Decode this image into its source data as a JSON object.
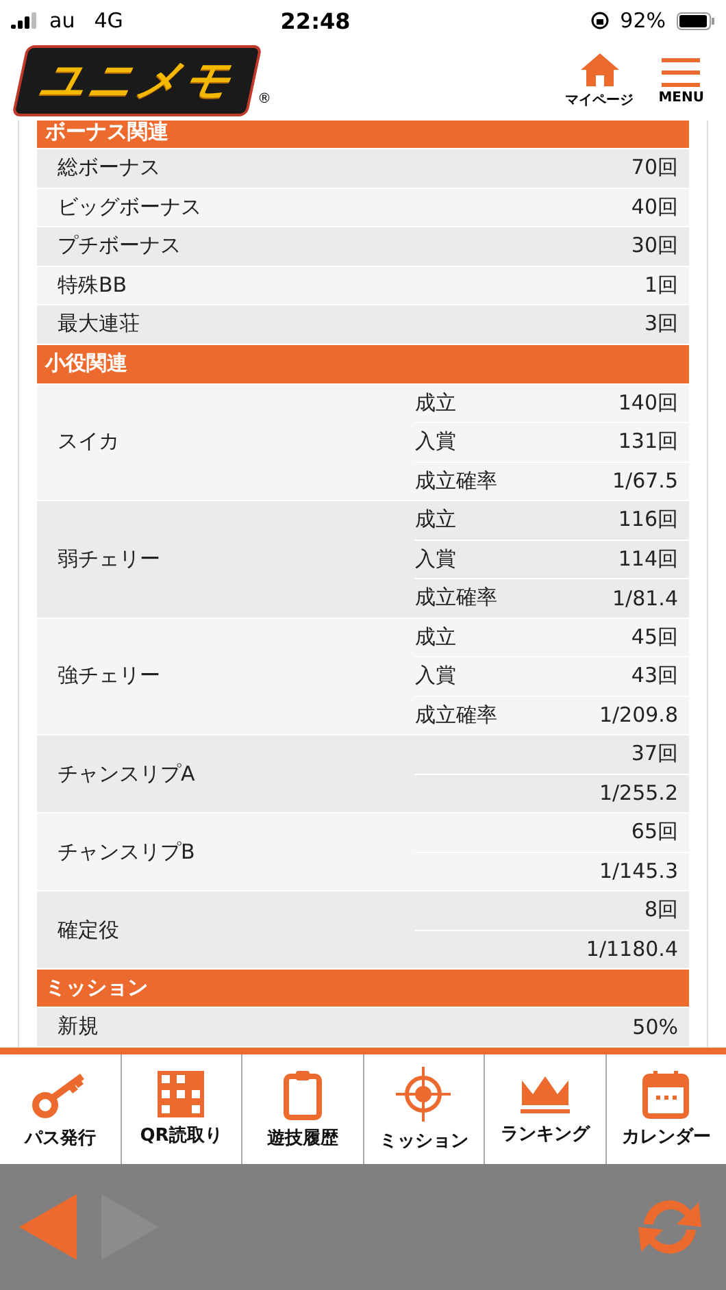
{
  "status_bar": {
    "carrier": "au",
    "network": "4G",
    "time": "22:48",
    "battery": "92%"
  },
  "header": {
    "logo": "ユニメモ",
    "logo_mark": "®",
    "buttons": [
      {
        "kind": "home",
        "label": "マイページ"
      },
      {
        "kind": "menu",
        "label": "MENU"
      }
    ]
  },
  "bonus": {
    "title": "ボーナス関連",
    "rows": [
      {
        "label": "総ボーナス",
        "value": "70回"
      },
      {
        "label": "ビッグボーナス",
        "value": "40回"
      },
      {
        "label": "プチボーナス",
        "value": "30回"
      },
      {
        "label": "特殊BB",
        "value": "1回"
      },
      {
        "label": "最大連荘",
        "value": "3回"
      }
    ]
  },
  "small_roles": {
    "title": "小役関連",
    "groups": [
      {
        "label": "スイカ",
        "rows": [
          {
            "label": "成立",
            "value": "140回"
          },
          {
            "label": "入賞",
            "value": "131回"
          },
          {
            "label": "成立確率",
            "value": "1/67.5"
          }
        ]
      },
      {
        "label": "弱チェリー",
        "rows": [
          {
            "label": "成立",
            "value": "116回"
          },
          {
            "label": "入賞",
            "value": "114回"
          },
          {
            "label": "成立確率",
            "value": "1/81.4"
          }
        ]
      },
      {
        "label": "強チェリー",
        "rows": [
          {
            "label": "成立",
            "value": "45回"
          },
          {
            "label": "入賞",
            "value": "43回"
          },
          {
            "label": "成立確率",
            "value": "1/209.8"
          }
        ]
      },
      {
        "label": "チャンスリプA",
        "rows": [
          {
            "value": "37回"
          },
          {
            "value": "1/255.2"
          }
        ]
      },
      {
        "label": "チャンスリプB",
        "rows": [
          {
            "value": "65回"
          },
          {
            "value": "1/145.3"
          }
        ]
      },
      {
        "label": "確定役",
        "rows": [
          {
            "value": "8回"
          },
          {
            "value": "1/1180.4"
          }
        ]
      }
    ]
  },
  "mission": {
    "title": "ミッション",
    "rows": [
      {
        "label": "新規",
        "value": "50%"
      }
    ]
  },
  "bottom_nav": [
    {
      "kind": "key",
      "label": "パス発行"
    },
    {
      "kind": "qr",
      "label": "QR読取り"
    },
    {
      "kind": "clipboard",
      "label": "遊技履歴"
    },
    {
      "kind": "target",
      "label": "ミッション"
    },
    {
      "kind": "crown",
      "label": "ランキング"
    },
    {
      "kind": "calendar",
      "label": "カレンダー"
    }
  ],
  "toolbar": {
    "back_enabled": true,
    "forward_enabled": false
  }
}
